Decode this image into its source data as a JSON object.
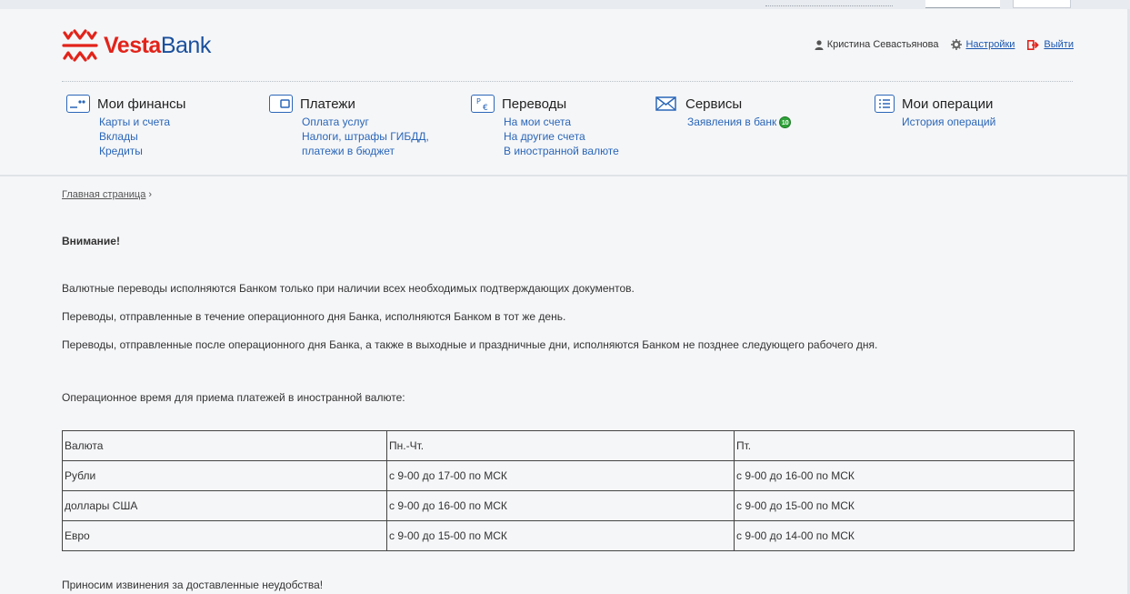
{
  "brand": {
    "vesta": "Vesta",
    "bank": "Bank"
  },
  "userbar": {
    "username": "Кристина Севастьянова",
    "settings": "Настройки",
    "logout": "Выйти"
  },
  "menu": [
    {
      "title": "Мои финансы",
      "icon": "wallet-card-icon",
      "links": [
        "Карты и счета",
        "Вклады",
        "Кредиты"
      ]
    },
    {
      "title": "Платежи",
      "icon": "wallet-icon",
      "links": [
        "Оплата услуг",
        "Налоги, штрафы ГИБДД,",
        "платежи в бюджет"
      ]
    },
    {
      "title": "Переводы",
      "icon": "currency-exchange-icon",
      "links": [
        "На мои счета",
        "На другие счета",
        "В иностранной валюте"
      ]
    },
    {
      "title": "Сервисы",
      "icon": "envelope-icon",
      "links": [
        "Заявления в банк"
      ],
      "badge": "10"
    },
    {
      "title": "Мои операции",
      "icon": "list-icon",
      "links": [
        "История операций"
      ]
    }
  ],
  "breadcrumb": {
    "home": "Главная страница",
    "sep": "›"
  },
  "notice": {
    "heading": "Внимание!",
    "p1": "Валютные переводы исполняются Банком только при наличии всех необходимых подтверждающих документов.",
    "p2": "Переводы, отправленные в течение операционного дня Банка, исполняются Банком в тот же день.",
    "p3": "Переводы, отправленные после операционного дня Банка, а также в выходные и праздничные дни, исполняются Банком не позднее следующего рабочего дня.",
    "table_intro": "Операционное время для приема платежей в иностранной валюте:",
    "apology": "Приносим извинения за доставленные неудобства!"
  },
  "table": {
    "headers": [
      "Валюта",
      "Пн.-Чт.",
      "Пт."
    ],
    "rows": [
      [
        "Рубли",
        "с 9-00 до 17-00 по МСК",
        "с 9-00 до 16-00 по МСК"
      ],
      [
        "доллары США",
        "с 9-00 до 16-00 по МСК",
        "с 9-00 до 15-00 по МСК"
      ],
      [
        "Евро",
        "с 9-00 до 15-00 по МСК",
        "с 9-00 до 14-00 по МСК"
      ]
    ]
  },
  "colors": {
    "brand_red": "#e2231a",
    "brand_blue": "#1a4f9c",
    "link": "#2a66b8",
    "badge_green": "#2fa33a"
  }
}
